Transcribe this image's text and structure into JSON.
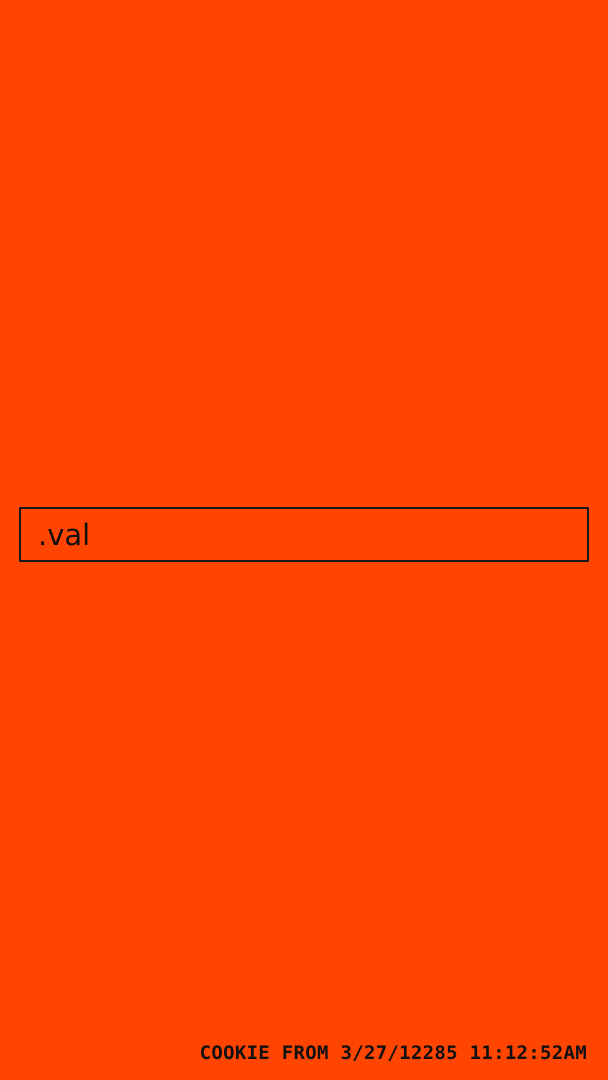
{
  "colors": {
    "background": "#FF4500",
    "text": "#111111",
    "border": "#1a1a1a"
  },
  "input": {
    "value": ".val",
    "placeholder": ""
  },
  "footer": {
    "cookie_text": "COOKIE FROM 3/27/12285 11:12:52AM"
  }
}
